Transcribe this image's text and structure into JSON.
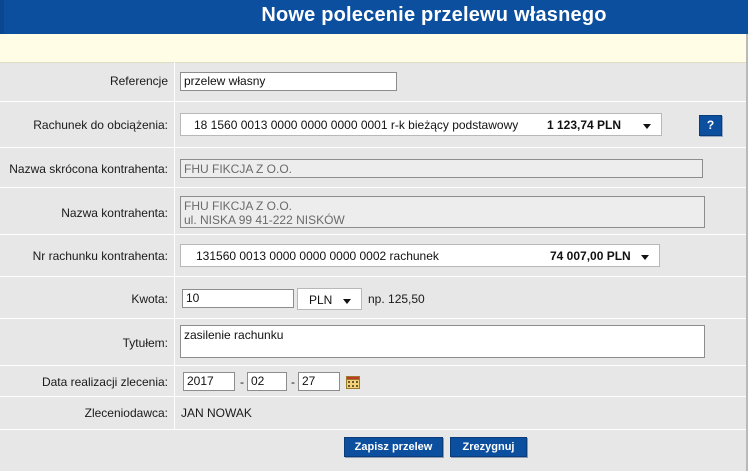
{
  "header": {
    "title": "Nowe polecenie przelewu własnego"
  },
  "form": {
    "reference": {
      "label": "Referencje",
      "value": "przelew własny"
    },
    "debit_account": {
      "label": "Rachunek do obciążenia:",
      "account": "18 1560 0013 0000 0000 0000 0001 r-k bieżący podstawowy",
      "balance": "1 123,74 PLN",
      "help_label": "?"
    },
    "short_name": {
      "label": "Nazwa skrócona kontrahenta:",
      "value": "FHU FIKCJA Z O.O."
    },
    "contractor_name": {
      "label": "Nazwa kontrahenta:",
      "line1": "FHU FIKCJA Z O.O.",
      "line2": "ul. NISKA 99 41-222 NISKÓW"
    },
    "contractor_account": {
      "label": "Nr rachunku kontrahenta:",
      "account": "131560 0013 0000 0000 0000 0002 rachunek",
      "balance": "74 007,00 PLN"
    },
    "amount": {
      "label": "Kwota:",
      "value": "10",
      "currency": "PLN",
      "hint": "np. 125,50"
    },
    "title": {
      "label": "Tytułem:",
      "value": "zasilenie rachunku"
    },
    "date": {
      "label": "Data realizacji zlecenia:",
      "year": "2017",
      "month": "02",
      "day": "27",
      "separator": "-"
    },
    "orderer": {
      "label": "Zleceniodawca:",
      "value": "JAN NOWAK"
    }
  },
  "actions": {
    "save_label": "Zapisz przelew",
    "cancel_label": "Zrezygnuj"
  },
  "icons": [
    "caret-down-icon",
    "calendar-icon"
  ],
  "colors": {
    "accent": "#0c4f9e",
    "background": "#e7e7e7",
    "notice": "#fffde6"
  }
}
